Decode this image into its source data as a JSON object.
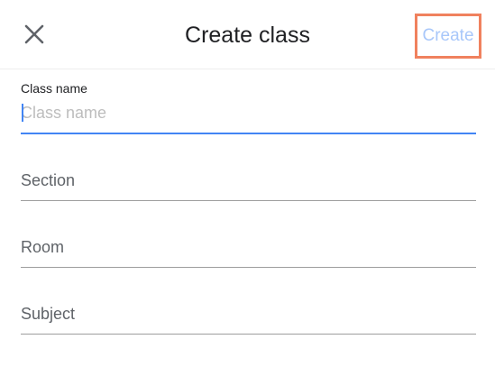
{
  "header": {
    "title": "Create class",
    "create_label": "Create"
  },
  "fields": {
    "class_name": {
      "label": "Class name",
      "value": "",
      "placeholder": "Class name"
    },
    "section": {
      "value": "",
      "placeholder": "Section"
    },
    "room": {
      "value": "",
      "placeholder": "Room"
    },
    "subject": {
      "value": "",
      "placeholder": "Subject"
    }
  },
  "colors": {
    "accent": "#4285f4",
    "create_text_disabled": "#a8c7fa",
    "highlight_box": "#f0815e"
  },
  "icons": {
    "close": "close-icon"
  }
}
